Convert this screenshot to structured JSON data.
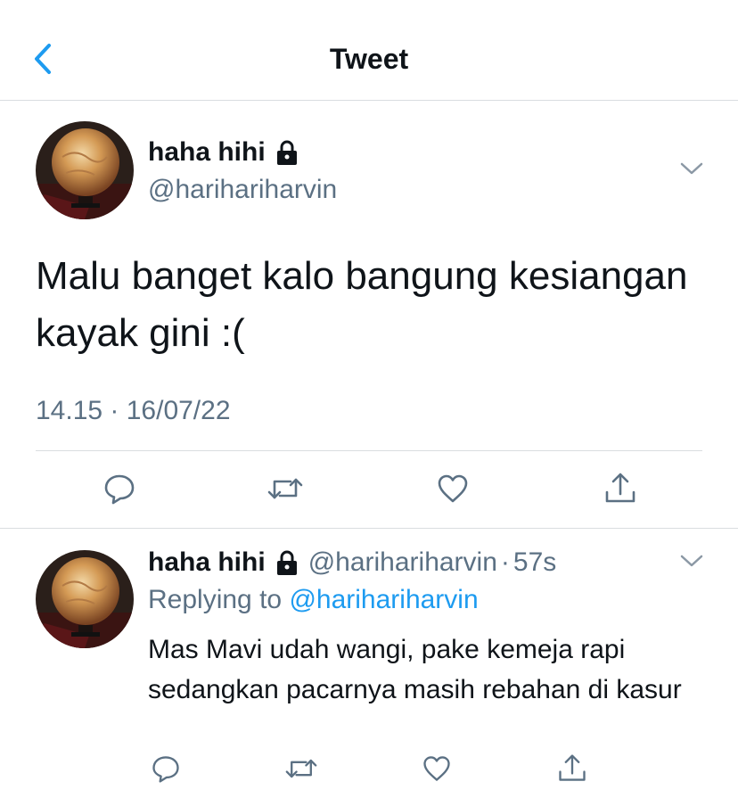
{
  "header": {
    "title": "Tweet"
  },
  "tweet": {
    "display_name": "haha hihi",
    "handle": "@harihariharvin",
    "text": "Malu banget kalo bangung kesiangan kayak gini :(",
    "timestamp": "14.15 · 16/07/22"
  },
  "reply": {
    "display_name": "haha hihi",
    "handle": "@harihariharvin",
    "separator": "·",
    "time": "57s",
    "replying_prefix": "Replying to",
    "replying_mention": "@harihariharvin",
    "text": "Mas Mavi udah wangi, pake kemeja rapi sedangkan pacarnya masih rebahan di kasur"
  },
  "icons": {
    "back": "chevron-left-icon",
    "lock": "lock-icon",
    "menu": "chevron-down-icon",
    "reply": "reply-bubble-icon",
    "retweet": "retweet-icon",
    "like": "heart-icon",
    "share": "share-icon"
  },
  "colors": {
    "accent": "#1d9bf0",
    "secondary_text": "#5b7083",
    "divider": "#d9dde0"
  }
}
